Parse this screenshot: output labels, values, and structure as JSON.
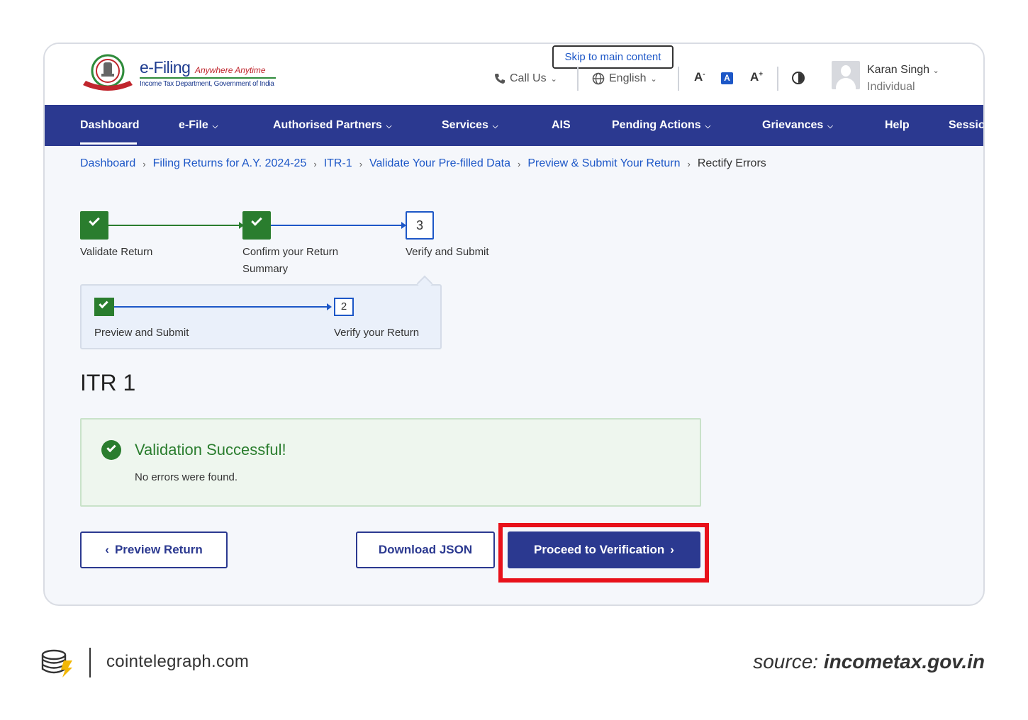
{
  "header": {
    "logo_title": "e-Filing",
    "logo_tagline": "Anywhere Anytime",
    "logo_subtitle": "Income Tax Department, Government of India",
    "skip_link": "Skip to main content",
    "call_us": "Call Us",
    "language": "English",
    "user_name": "Karan Singh",
    "user_role": "Individual"
  },
  "nav": {
    "items": [
      {
        "label": "Dashboard",
        "has_menu": false,
        "active": true
      },
      {
        "label": "e-File",
        "has_menu": true
      },
      {
        "label": "Authorised Partners",
        "has_menu": true
      },
      {
        "label": "Services",
        "has_menu": true
      },
      {
        "label": "AIS",
        "has_menu": false
      },
      {
        "label": "Pending Actions",
        "has_menu": true
      },
      {
        "label": "Grievances",
        "has_menu": true
      },
      {
        "label": "Help",
        "has_menu": false
      },
      {
        "label": "Sessio",
        "has_menu": false
      }
    ]
  },
  "breadcrumb": {
    "items": [
      "Dashboard",
      "Filing Returns for A.Y. 2024-25",
      "ITR-1",
      "Validate Your Pre-filled Data",
      "Preview & Submit Your Return"
    ],
    "current": "Rectify Errors"
  },
  "stepper": {
    "steps": [
      {
        "label": "Validate Return",
        "status": "done"
      },
      {
        "label_line1": "Confirm your Return",
        "label_line2": "Summary",
        "status": "done"
      },
      {
        "number": "3",
        "label": "Verify and Submit",
        "status": "current"
      }
    ],
    "substeps": [
      {
        "label": "Preview and Submit",
        "status": "done"
      },
      {
        "number": "2",
        "label": "Verify your Return",
        "status": "current"
      }
    ]
  },
  "main": {
    "title": "ITR 1",
    "success_title": "Validation Successful!",
    "success_message": "No errors were found."
  },
  "buttons": {
    "preview": "Preview Return",
    "download": "Download JSON",
    "proceed": "Proceed to Verification"
  },
  "footer": {
    "site": "cointelegraph.com",
    "source_prefix": "source:",
    "source_domain": "incometax.gov.in"
  },
  "colors": {
    "nav_bg": "#2b3990",
    "success_green": "#2a7d2e",
    "link_blue": "#1d57c7",
    "highlight_red": "#e8111a"
  }
}
